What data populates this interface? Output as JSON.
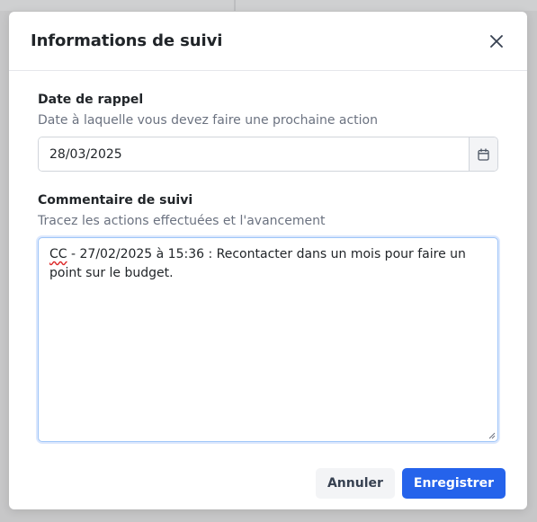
{
  "modal": {
    "title": "Informations de suivi",
    "close_icon": "close-icon"
  },
  "reminder": {
    "label": "Date de rappel",
    "help": "Date à laquelle vous devez faire une prochaine action",
    "value": "28/03/2025",
    "calendar_icon": "calendar-icon"
  },
  "comment": {
    "label": "Commentaire de suivi",
    "help": "Tracez les actions effectuées et l'avancement",
    "prefix": "CC",
    "value": " - 27/02/2025 à 15:36 : Recontacter dans un mois pour faire un point sur le budget."
  },
  "footer": {
    "cancel_label": "Annuler",
    "save_label": "Enregistrer"
  },
  "colors": {
    "primary": "#2563eb",
    "focus_border": "#9ec5f8",
    "backdrop": "#c7c7c8"
  }
}
